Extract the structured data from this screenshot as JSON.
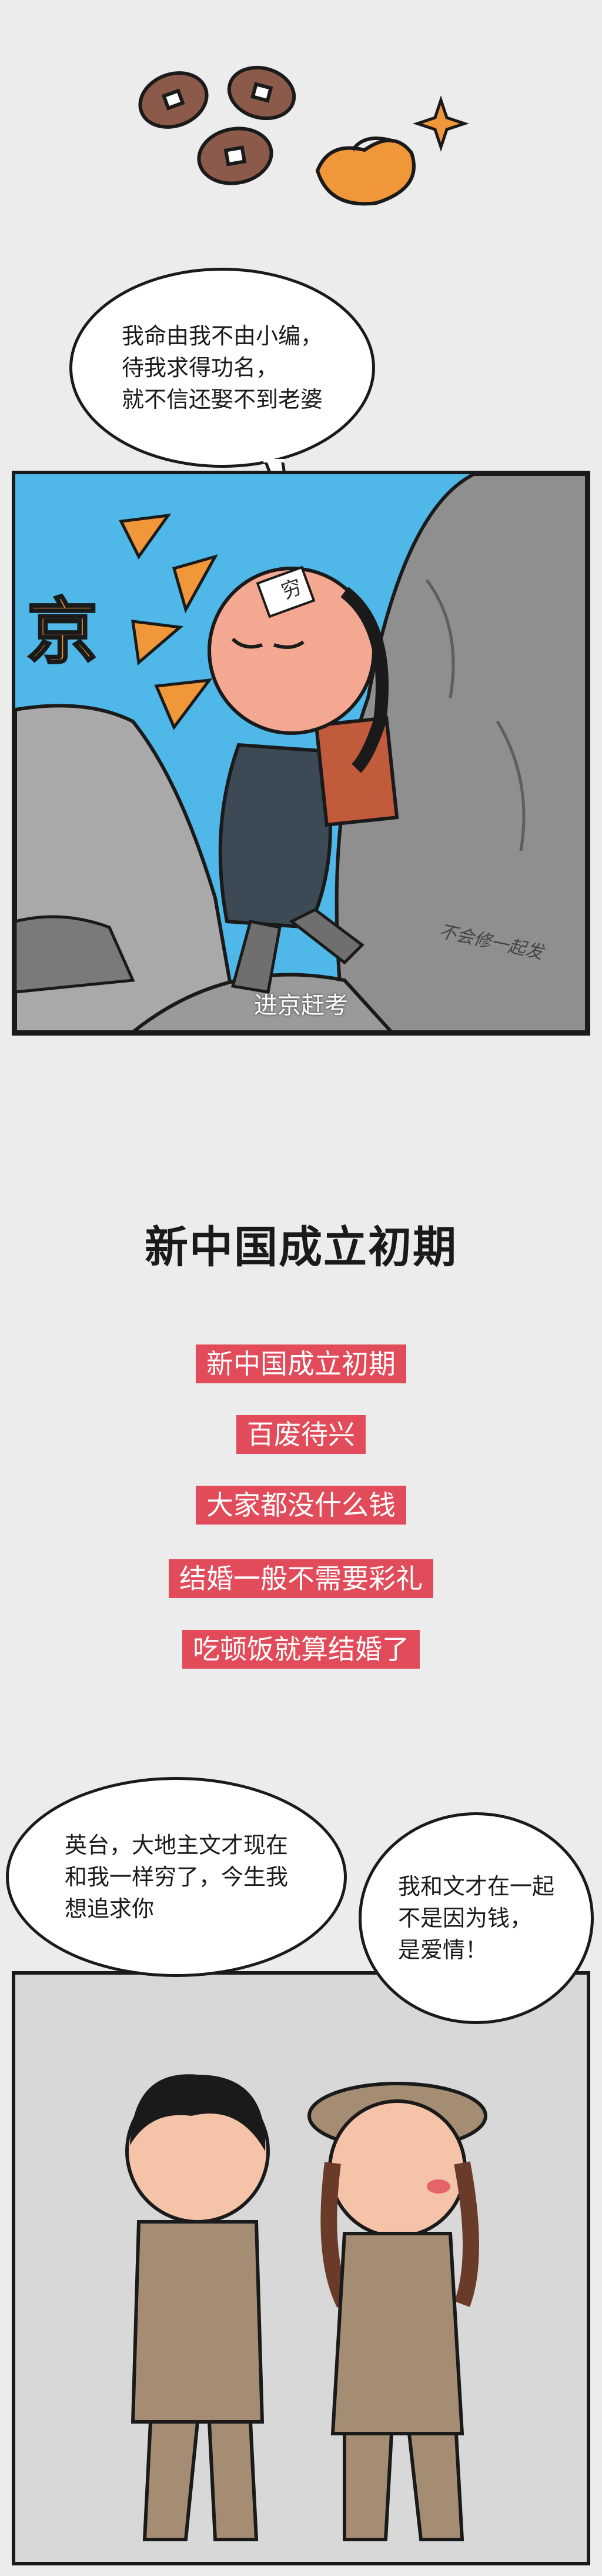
{
  "comic1": {
    "bubble_text": "我命由我不由小编，\n待我求得功名，\n就不信还娶不到老婆",
    "caption": "进京赶考",
    "sound_effect": "京",
    "badge_text": "穷",
    "signature": "不会修一起发"
  },
  "section": {
    "title": "新中国成立初期",
    "tags": [
      "新中国成立初期",
      "百废待兴",
      "大家都没什么钱",
      "结婚一般不需要彩礼",
      "吃顿饭就算结婚了"
    ]
  },
  "comic2": {
    "bubble_left": "英台，大地主文才现在\n和我一样穷了，今生我\n想追求你",
    "bubble_right": "我和文才在一起\n不是因为钱，\n是爱情！"
  },
  "colors": {
    "tag_bg": "#e24b59",
    "sky": "#4fb8e8",
    "rock": "#8a8a8a",
    "gold": "#f0973a"
  }
}
